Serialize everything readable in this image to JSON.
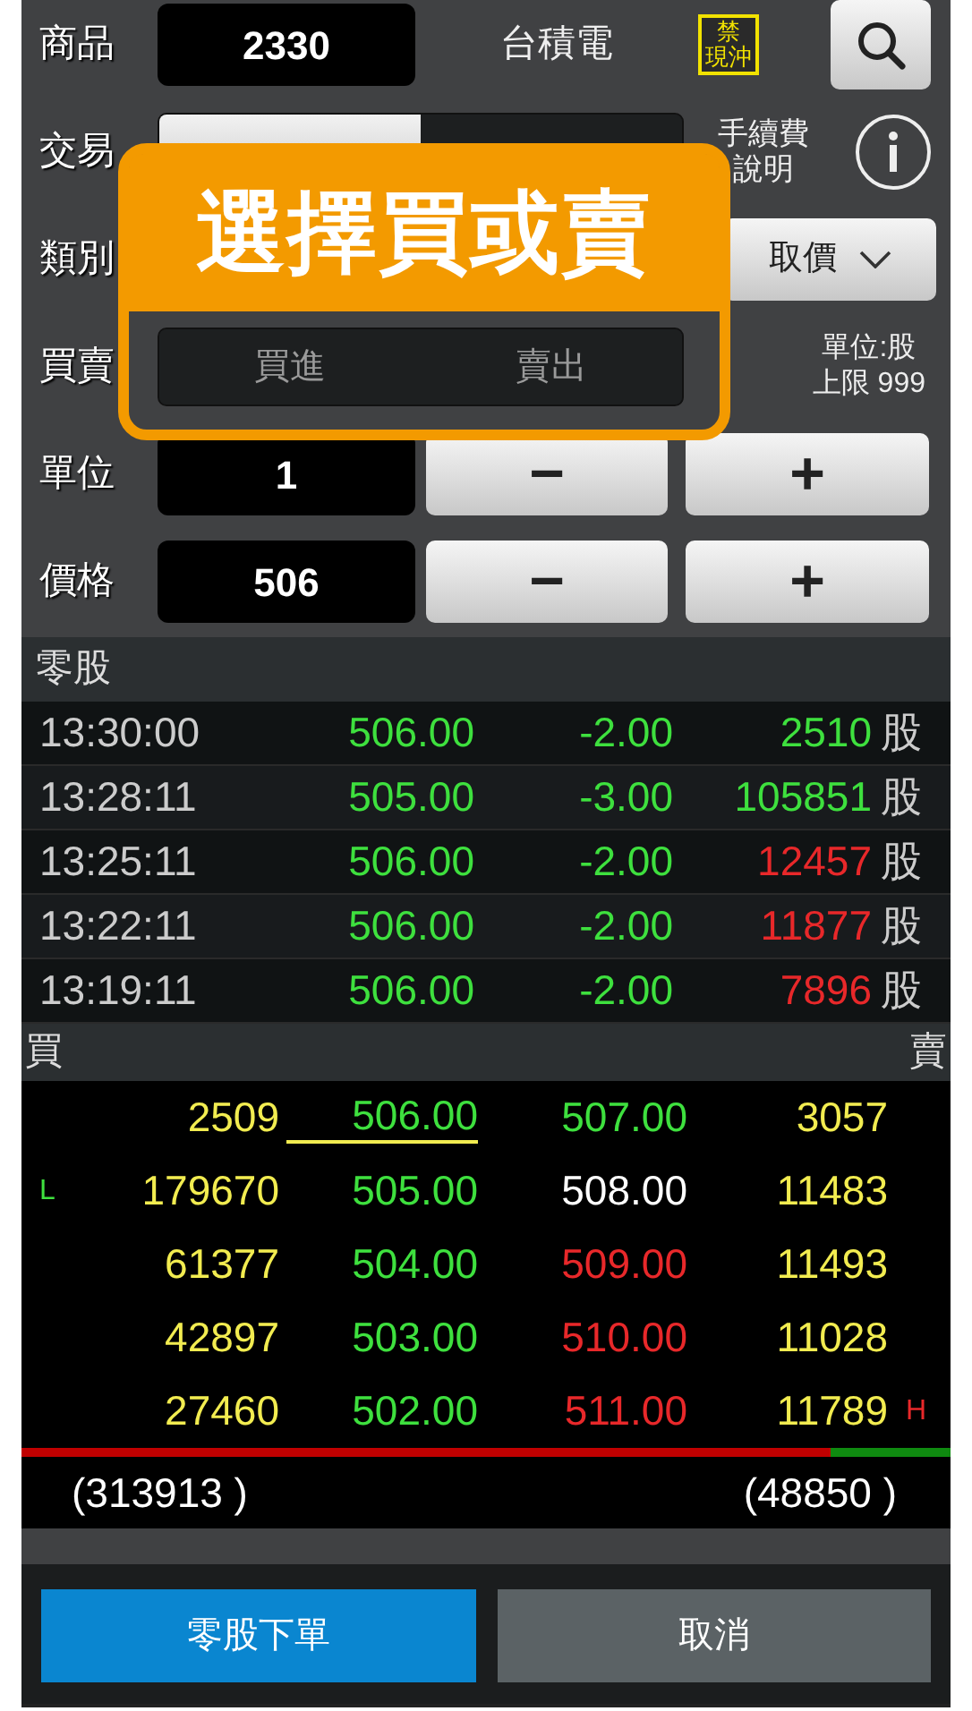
{
  "product": {
    "label": "商品",
    "code": "2330",
    "name": "台積電",
    "badge_lines": [
      "禁",
      "現沖"
    ]
  },
  "trade": {
    "label": "交易",
    "tabs": [
      {
        "selected": true
      },
      {
        "selected": false
      }
    ],
    "fee_help": "手續費說明"
  },
  "category": {
    "label": "類別",
    "price_button": "取價"
  },
  "side": {
    "label": "買賣",
    "options": [
      {
        "label": "買進",
        "selected": false
      },
      {
        "label": "賣出",
        "selected": false
      }
    ],
    "note_lines": [
      "單位:股",
      "上限 999"
    ]
  },
  "callout": {
    "text": "選擇買或賣"
  },
  "quantity": {
    "label": "單位",
    "value": "1",
    "minus": "−",
    "plus": "+"
  },
  "price": {
    "label": "價格",
    "value": "506",
    "minus": "−",
    "plus": "+"
  },
  "trades": {
    "title": "零股",
    "rows": [
      {
        "time": "13:30:00",
        "price": "506.00",
        "change": "-2.00",
        "volume": "2510",
        "unit": "股",
        "color": "#3ee03e"
      },
      {
        "time": "13:28:11",
        "price": "505.00",
        "change": "-3.00",
        "volume": "105851",
        "unit": "股",
        "color": "#3ee03e"
      },
      {
        "time": "13:25:11",
        "price": "506.00",
        "change": "-2.00",
        "volume": "12457",
        "unit": "股",
        "color": "#e8282a"
      },
      {
        "time": "13:22:11",
        "price": "506.00",
        "change": "-2.00",
        "volume": "11877",
        "unit": "股",
        "color": "#e8282a"
      },
      {
        "time": "13:19:11",
        "price": "506.00",
        "change": "-2.00",
        "volume": "7896",
        "unit": "股",
        "color": "#e8282a"
      }
    ]
  },
  "book": {
    "bid_label": "買",
    "ask_label": "賣",
    "rows": [
      {
        "bid_volume": "2509",
        "bid_price": "506.00",
        "underlined": true,
        "ask_price": "507.00",
        "color": "#3ee03e",
        "ask_volume": "3057"
      },
      {
        "low_mark": "L",
        "bid_volume": "179670",
        "bid_price": "505.00",
        "underlined": false,
        "ask_price": "508.00",
        "color": "#ffffff",
        "ask_volume": "11483"
      },
      {
        "bid_volume": "61377",
        "bid_price": "504.00",
        "underlined": false,
        "ask_price": "509.00",
        "color": "#e8282a",
        "ask_volume": "11493"
      },
      {
        "bid_volume": "42897",
        "bid_price": "503.00",
        "underlined": false,
        "ask_price": "510.00",
        "color": "#e8282a",
        "ask_volume": "11028"
      },
      {
        "bid_volume": "27460",
        "bid_price": "502.00",
        "underlined": false,
        "ask_price": "511.00",
        "color": "#e8282a",
        "ask_volume": "11789",
        "high_mark": "H"
      }
    ],
    "level": 0.87,
    "bid_total": "(313913 )",
    "ask_total": "(48850 )"
  },
  "actions": [
    {
      "label": "零股下單",
      "kind": "primary"
    },
    {
      "label": "取消",
      "kind": "secondary"
    }
  ]
}
